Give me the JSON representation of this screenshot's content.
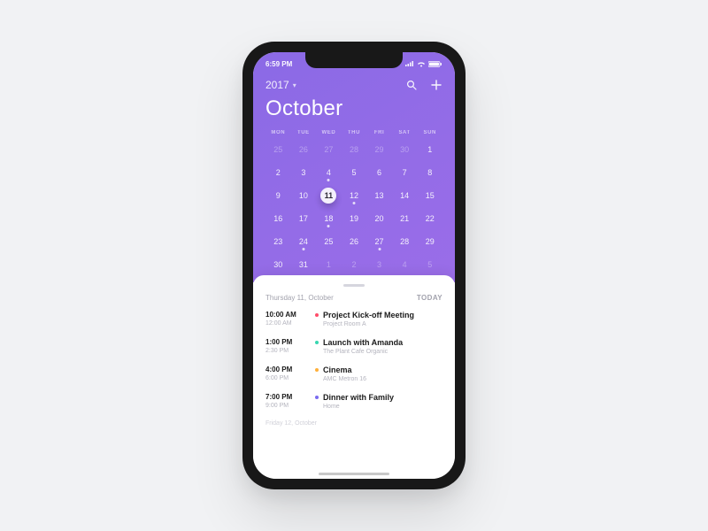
{
  "statusbar": {
    "time": "6:59 PM",
    "signal": "•••",
    "wifi": "wifi",
    "battery": "100"
  },
  "header": {
    "year": "2017",
    "month": "October"
  },
  "weekdays": [
    "MON",
    "TUE",
    "WED",
    "THU",
    "FRI",
    "SAT",
    "SUN"
  ],
  "grid": [
    [
      25,
      26,
      27,
      28,
      29,
      30,
      1
    ],
    [
      2,
      3,
      4,
      5,
      6,
      7,
      8
    ],
    [
      9,
      10,
      11,
      12,
      13,
      14,
      15
    ],
    [
      16,
      17,
      18,
      19,
      20,
      21,
      22
    ],
    [
      23,
      24,
      25,
      26,
      27,
      28,
      29
    ],
    [
      30,
      31,
      1,
      2,
      3,
      4,
      5
    ]
  ],
  "selected_day": 11,
  "dots_on": [
    4,
    12,
    18,
    24,
    27
  ],
  "other_month_cells": [
    0,
    1,
    2,
    3,
    4,
    5,
    37,
    38,
    39,
    40,
    41
  ],
  "list": {
    "date_heading": "Thursday 11, October",
    "today_label": "TODAY",
    "events": [
      {
        "start": "10:00 AM",
        "end": "12:00 AM",
        "title": "Project Kick-off Meeting",
        "sub": "Project Room A",
        "color": "#ff4d6a"
      },
      {
        "start": "1:00 PM",
        "end": "2:30 PM",
        "title": "Launch with Amanda",
        "sub": "The Plant Cafe Organic",
        "color": "#38d6b0"
      },
      {
        "start": "4:00 PM",
        "end": "6:00 PM",
        "title": "Cinema",
        "sub": "AMC Metron 16",
        "color": "#ffb03a"
      },
      {
        "start": "7:00 PM",
        "end": "9:00 PM",
        "title": "Dinner with Family",
        "sub": "Home",
        "color": "#7a6bf0"
      }
    ],
    "next_heading": "Friday 12, October"
  }
}
